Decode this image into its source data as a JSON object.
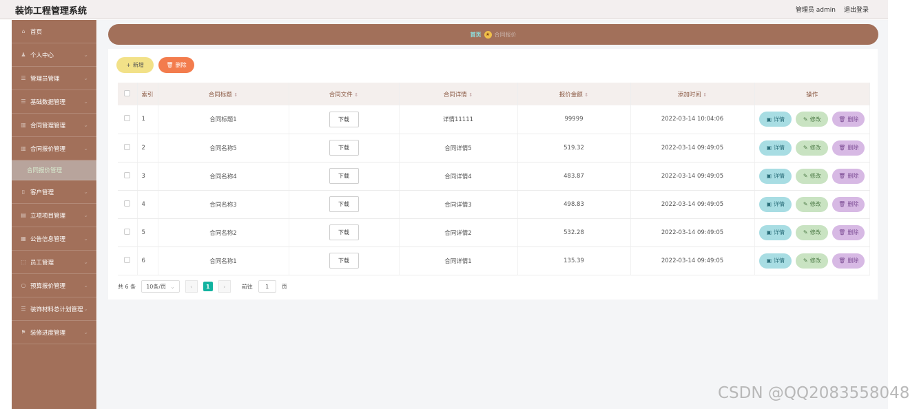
{
  "header": {
    "title": "装饰工程管理系统",
    "user": "管理员 admin",
    "logout": "退出登录"
  },
  "sidebar": {
    "items": [
      {
        "label": "首页",
        "icon": "home-icon",
        "glyph": "⌂"
      },
      {
        "label": "个人中心",
        "icon": "user-icon",
        "glyph": "♟"
      },
      {
        "label": "管理员管理",
        "icon": "list-icon",
        "glyph": "☰"
      },
      {
        "label": "基础数据管理",
        "icon": "list-icon",
        "glyph": "☰"
      },
      {
        "label": "合同管理管理",
        "icon": "chart-icon",
        "glyph": "▥"
      },
      {
        "label": "合同报价管理",
        "icon": "chart-icon",
        "glyph": "▥"
      }
    ],
    "active_sub": "合同报价管理",
    "items2": [
      {
        "label": "客户管理",
        "icon": "phone-icon",
        "glyph": "▯"
      },
      {
        "label": "立项项目管理",
        "icon": "card-icon",
        "glyph": "▤"
      },
      {
        "label": "公告信息管理",
        "icon": "doc-icon",
        "glyph": "▦"
      },
      {
        "label": "员工管理",
        "icon": "frame-icon",
        "glyph": "⬚"
      },
      {
        "label": "预算报价管理",
        "icon": "circle-icon",
        "glyph": "○"
      },
      {
        "label": "装饰材料总计划管理",
        "icon": "list-icon",
        "glyph": "☰"
      },
      {
        "label": "装修进度管理",
        "icon": "flag-icon",
        "glyph": "⚑"
      }
    ]
  },
  "breadcrumb": {
    "home": "首页",
    "current": "合同报价"
  },
  "toolbar": {
    "add_label": "新增",
    "delete_label": "删除"
  },
  "table": {
    "headers": {
      "index": "索引",
      "title": "合同标题",
      "file": "合同文件",
      "detail": "合同详情",
      "amount": "报价金额",
      "time": "添加时间",
      "ops": "操作"
    },
    "download_label": "下载",
    "op_detail": "详情",
    "op_edit": "修改",
    "op_remove": "删除",
    "rows": [
      {
        "index": "1",
        "title": "合同标题1",
        "detail": "详情11111",
        "amount": "99999",
        "time": "2022-03-14 10:04:06"
      },
      {
        "index": "2",
        "title": "合同名称5",
        "detail": "合同详情5",
        "amount": "519.32",
        "time": "2022-03-14 09:49:05"
      },
      {
        "index": "3",
        "title": "合同名称4",
        "detail": "合同详情4",
        "amount": "483.87",
        "time": "2022-03-14 09:49:05"
      },
      {
        "index": "4",
        "title": "合同名称3",
        "detail": "合同详情3",
        "amount": "498.83",
        "time": "2022-03-14 09:49:05"
      },
      {
        "index": "5",
        "title": "合同名称2",
        "detail": "合同详情2",
        "amount": "532.28",
        "time": "2022-03-14 09:49:05"
      },
      {
        "index": "6",
        "title": "合同名称1",
        "detail": "合同详情1",
        "amount": "135.39",
        "time": "2022-03-14 09:49:05"
      }
    ]
  },
  "pagination": {
    "total": "共 6 条",
    "page_size": "10条/页",
    "current_page": "1",
    "goto_prefix": "前往",
    "goto_value": "1",
    "goto_suffix": "页"
  },
  "watermark": "CSDN @QQ2083558048"
}
